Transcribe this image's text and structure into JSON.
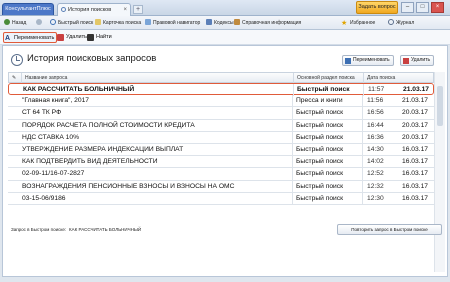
{
  "titlebar": {
    "app_tab": "КонсультантПлюс",
    "doc_tab": "История поисков",
    "ask_button": "Задать вопрос"
  },
  "nav": {
    "back": "Назад",
    "quick_search": "Быстрый поиск",
    "card_search": "Карточка поиска",
    "legal_navigator": "Правовой навигатор",
    "codes": "Кодексы",
    "reference": "Справочная информация",
    "favorites": "Избранное",
    "journal": "Журнал"
  },
  "toolbar": {
    "rename": "Переименовать",
    "delete": "Удалить",
    "find": "Найти"
  },
  "page": {
    "title": "История поисковых запросов",
    "rename_button": "Переименовать",
    "delete_button": "Удалить"
  },
  "table": {
    "headers": {
      "query": "Название запроса",
      "section": "Основной раздел поиска",
      "date": "Дата поиска"
    },
    "rows": [
      {
        "query": "КАК РАССЧИТАТЬ БОЛЬНИЧНЫЙ",
        "section": "Быстрый поиск",
        "time": "11:57",
        "date": "21.03.17"
      },
      {
        "query": "\"Главная книга\", 2017",
        "section": "Пресса и книги",
        "time": "11:56",
        "date": "21.03.17"
      },
      {
        "query": "СТ 64 ТК РФ",
        "section": "Быстрый поиск",
        "time": "16:56",
        "date": "20.03.17"
      },
      {
        "query": "ПОРЯДОК РАСЧЕТА ПОЛНОЙ СТОИМОСТИ КРЕДИТА",
        "section": "Быстрый поиск",
        "time": "16:44",
        "date": "20.03.17"
      },
      {
        "query": "НДС СТАВКА 10%",
        "section": "Быстрый поиск",
        "time": "16:36",
        "date": "20.03.17"
      },
      {
        "query": "УТВЕРЖДЕНИЕ РАЗМЕРА ИНДЕКСАЦИИ ВЫПЛАТ",
        "section": "Быстрый поиск",
        "time": "14:30",
        "date": "16.03.17"
      },
      {
        "query": "КАК ПОДТВЕРДИТЬ ВИД ДЕЯТЕЛЬНОСТИ",
        "section": "Быстрый поиск",
        "time": "14:02",
        "date": "16.03.17"
      },
      {
        "query": "02-09-11/16-07-2827",
        "section": "Быстрый поиск",
        "time": "12:52",
        "date": "16.03.17"
      },
      {
        "query": "ВОЗНАГРАЖДЕНИЯ ПЕНСИОННЫЕ ВЗНОСЫ И ВЗНОСЫ НА ОМС",
        "section": "Быстрый поиск",
        "time": "12:32",
        "date": "16.03.17"
      },
      {
        "query": "03-15-06/9186",
        "section": "Быстрый поиск",
        "time": "12:30",
        "date": "16.03.17"
      }
    ]
  },
  "footer": {
    "label": "Запрос в Быстром поиске:",
    "value": "КАК РАССЧИТАТЬ БОЛЬНИЧНЫЙ",
    "repeat_button": "Повторить запрос в Быстром поиске"
  },
  "colors": {
    "highlight": "#e05b3a",
    "accent": "#4d78c8"
  }
}
